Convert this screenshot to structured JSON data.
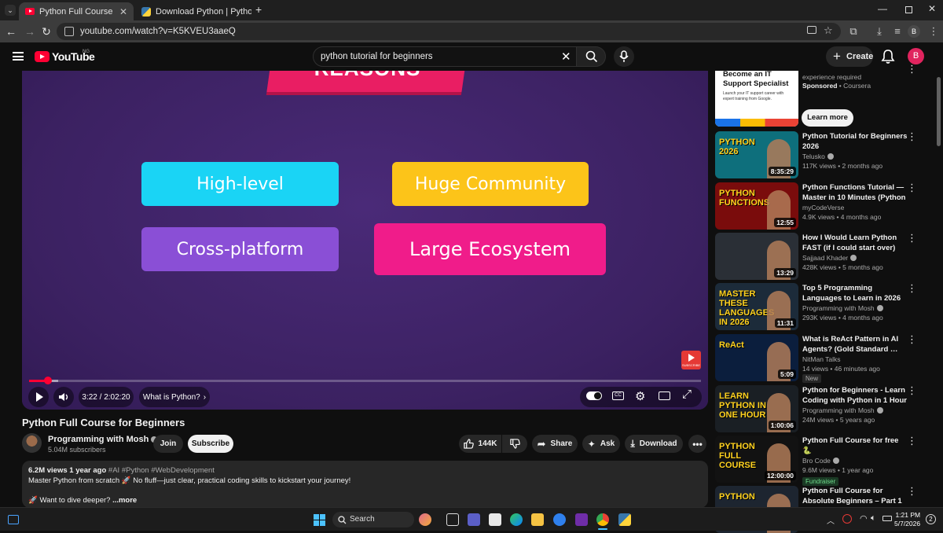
{
  "browser": {
    "tabs": [
      {
        "title": "Python Full Course for Beginners",
        "active": true
      },
      {
        "title": "Download Python | Python.org",
        "active": false
      }
    ],
    "url": "youtube.com/watch?v=K5KVEU3aaeQ"
  },
  "header": {
    "logo": "YouTube",
    "country": "NG",
    "search_value": "python tutorial for beginners",
    "create_label": "Create",
    "avatar_letter": "B",
    "browser_avatar_letter": "B"
  },
  "player": {
    "slide_heading": "REASONS",
    "cards": [
      {
        "label": "High-level",
        "color": "#1ad4f5"
      },
      {
        "label": "Huge Community",
        "color": "#fcc419"
      },
      {
        "label": "Cross-platform",
        "color": "#8a4fd6"
      },
      {
        "label": "Large Ecosystem",
        "color": "#f01c8a"
      }
    ],
    "time": "3:22 / 2:02:20",
    "chapter": "What is Python?",
    "progress_fraction": 0.0275,
    "buffered_fraction": 0.043,
    "subscribe_watermark": "SUBSCRIBE"
  },
  "video": {
    "title": "Python Full Course for Beginners",
    "channel": "Programming with Mosh",
    "subscribers": "5.04M subscribers",
    "join_label": "Join",
    "subscribe_label": "Subscribe",
    "likes": "144K",
    "share_label": "Share",
    "ask_label": "Ask",
    "download_label": "Download",
    "description": {
      "views_date": "6.2M views  1 year ago",
      "tags": "#AI #Python #WebDevelopment",
      "line1": "Master Python from scratch 🚀 No fluff—just clear, practical coding skills to kickstart your journey!",
      "line2": "🚀 Want to dive deeper?",
      "more": "...more"
    }
  },
  "sidebar": {
    "ad": {
      "title": "Become an IT Support Specialist",
      "body": "Launch your IT support career with expert training from Google.",
      "meta": "experience required",
      "sponsored": "Sponsored",
      "advertiser": "Coursera",
      "cta": "Learn more"
    },
    "videos": [
      {
        "title": "Python Tutorial for Beginners 2026",
        "channel": "Telusko",
        "meta": "117K views • 2 months ago",
        "duration": "8:35:29",
        "thumb_text": "PYTHON 2026",
        "thumb_bg": "#0e6f7c",
        "verified": true
      },
      {
        "title": "Python Functions Tutorial — Master in 10 Minutes (Python …",
        "channel": "myCodeVerse",
        "meta": "4.9K views • 4 months ago",
        "duration": "12:55",
        "thumb_text": "PYTHON FUNCTIONS",
        "thumb_bg": "#7a0c0c",
        "verified": false
      },
      {
        "title": "How I Would Learn Python FAST (if I could start over)",
        "channel": "Sajjaad Khader",
        "meta": "428K views • 5 months ago",
        "duration": "13:29",
        "thumb_text": "",
        "thumb_bg": "#2a2f36",
        "verified": true
      },
      {
        "title": "Top 5 Programming Languages to Learn in 2026 (to Actually G…",
        "channel": "Programming with Mosh",
        "meta": "293K views • 4 months ago",
        "duration": "11:31",
        "thumb_text": "MASTER THESE LANGUAGES IN 2026",
        "thumb_bg": "#1c2b3a",
        "verified": true
      },
      {
        "title": "What is ReAct Pattern in AI Agents? (Gold Standard …",
        "channel": "NitMan Talks",
        "meta": "14 views • 46 minutes ago",
        "duration": "5:09",
        "thumb_text": "ReAct",
        "thumb_bg": "#0b1e3d",
        "verified": false,
        "badge": "New"
      },
      {
        "title": "Python for Beginners - Learn Coding with Python in 1 Hour",
        "channel": "Programming with Mosh",
        "meta": "24M views • 5 years ago",
        "duration": "1:00:06",
        "thumb_text": "LEARN PYTHON IN ONE HOUR",
        "thumb_bg": "#1a1f24",
        "verified": true
      },
      {
        "title": "Python Full Course for free 🐍",
        "channel": "Bro Code",
        "meta": "9.6M views • 1 year ago",
        "duration": "12:00:00",
        "thumb_text": "PYTHON FULL COURSE",
        "thumb_bg": "#121212",
        "verified": true,
        "badge": "Fundraiser"
      },
      {
        "title": "Python Full Course for Absolute Beginners – Part 1",
        "channel": "",
        "meta": "",
        "duration": "",
        "thumb_text": "PYTHON",
        "thumb_bg": "#1d2530",
        "verified": false
      }
    ]
  },
  "taskbar": {
    "search_label": "Search",
    "time": "1:21 PM",
    "date": "5/7/2026",
    "notifications": "2"
  }
}
